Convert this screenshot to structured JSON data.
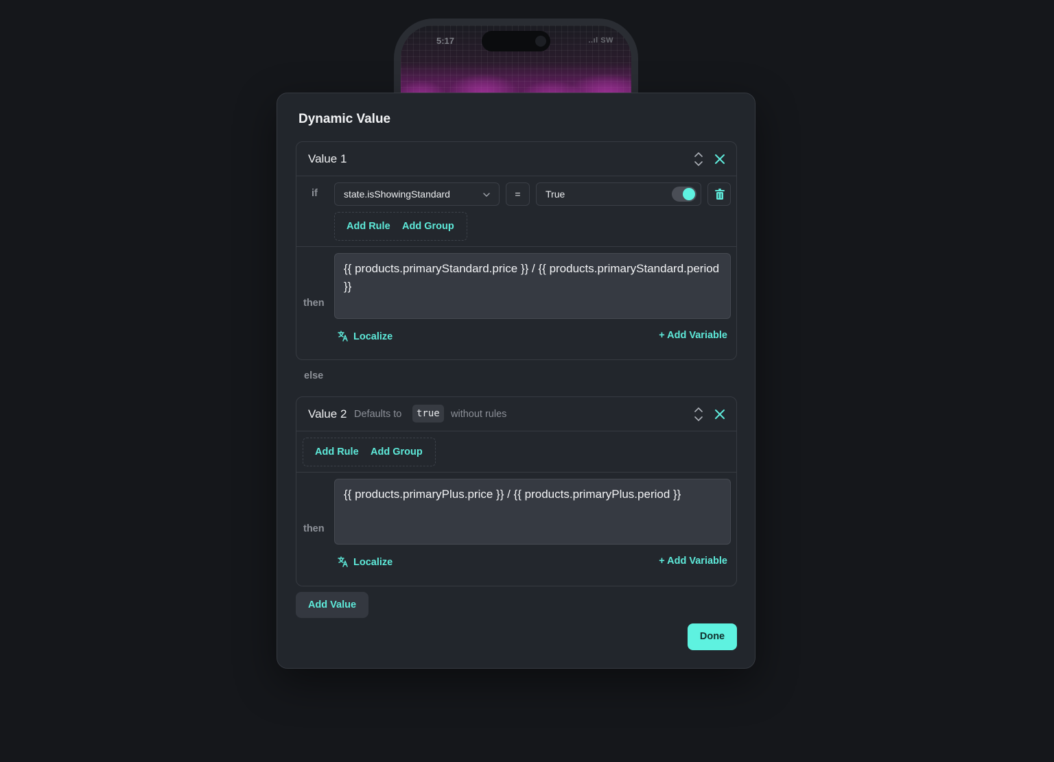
{
  "phone": {
    "time": "5:17",
    "status": "..ıl SW"
  },
  "modal": {
    "title": "Dynamic Value",
    "value1": {
      "title": "Value 1",
      "if_label": "if",
      "condition": {
        "variable": "state.isShowingStandard",
        "operator": "=",
        "value": "True",
        "toggle_on": true
      },
      "add_rule_label": "Add Rule",
      "add_group_label": "Add Group",
      "then_label": "then",
      "text": "{{ products.primaryStandard.price }} / {{ products.primaryStandard.period }}",
      "localize_label": "Localize",
      "add_variable_label": "+ Add Variable"
    },
    "else_label": "else",
    "value2": {
      "title": "Value 2",
      "defaults_to_label": "Defaults to",
      "defaults_value": "true",
      "without_rules_label": "without rules",
      "add_rule_label": "Add Rule",
      "add_group_label": "Add Group",
      "then_label": "then",
      "text": "{{ products.primaryPlus.price }} / {{ products.primaryPlus.period }}",
      "localize_label": "Localize",
      "add_variable_label": "+ Add Variable"
    },
    "add_value_label": "Add Value",
    "done_label": "Done"
  },
  "colors": {
    "background": "#15171b",
    "modal": "#22262c",
    "accent": "#5ef2e0",
    "link": "#5eeada",
    "phone_glow": "#d844ce"
  },
  "icons": {
    "chevron": "chevron-down-icon",
    "reorder": "sort-arrows-icon",
    "close": "close-icon",
    "delete": "trash-icon",
    "translate": "translate-icon"
  }
}
